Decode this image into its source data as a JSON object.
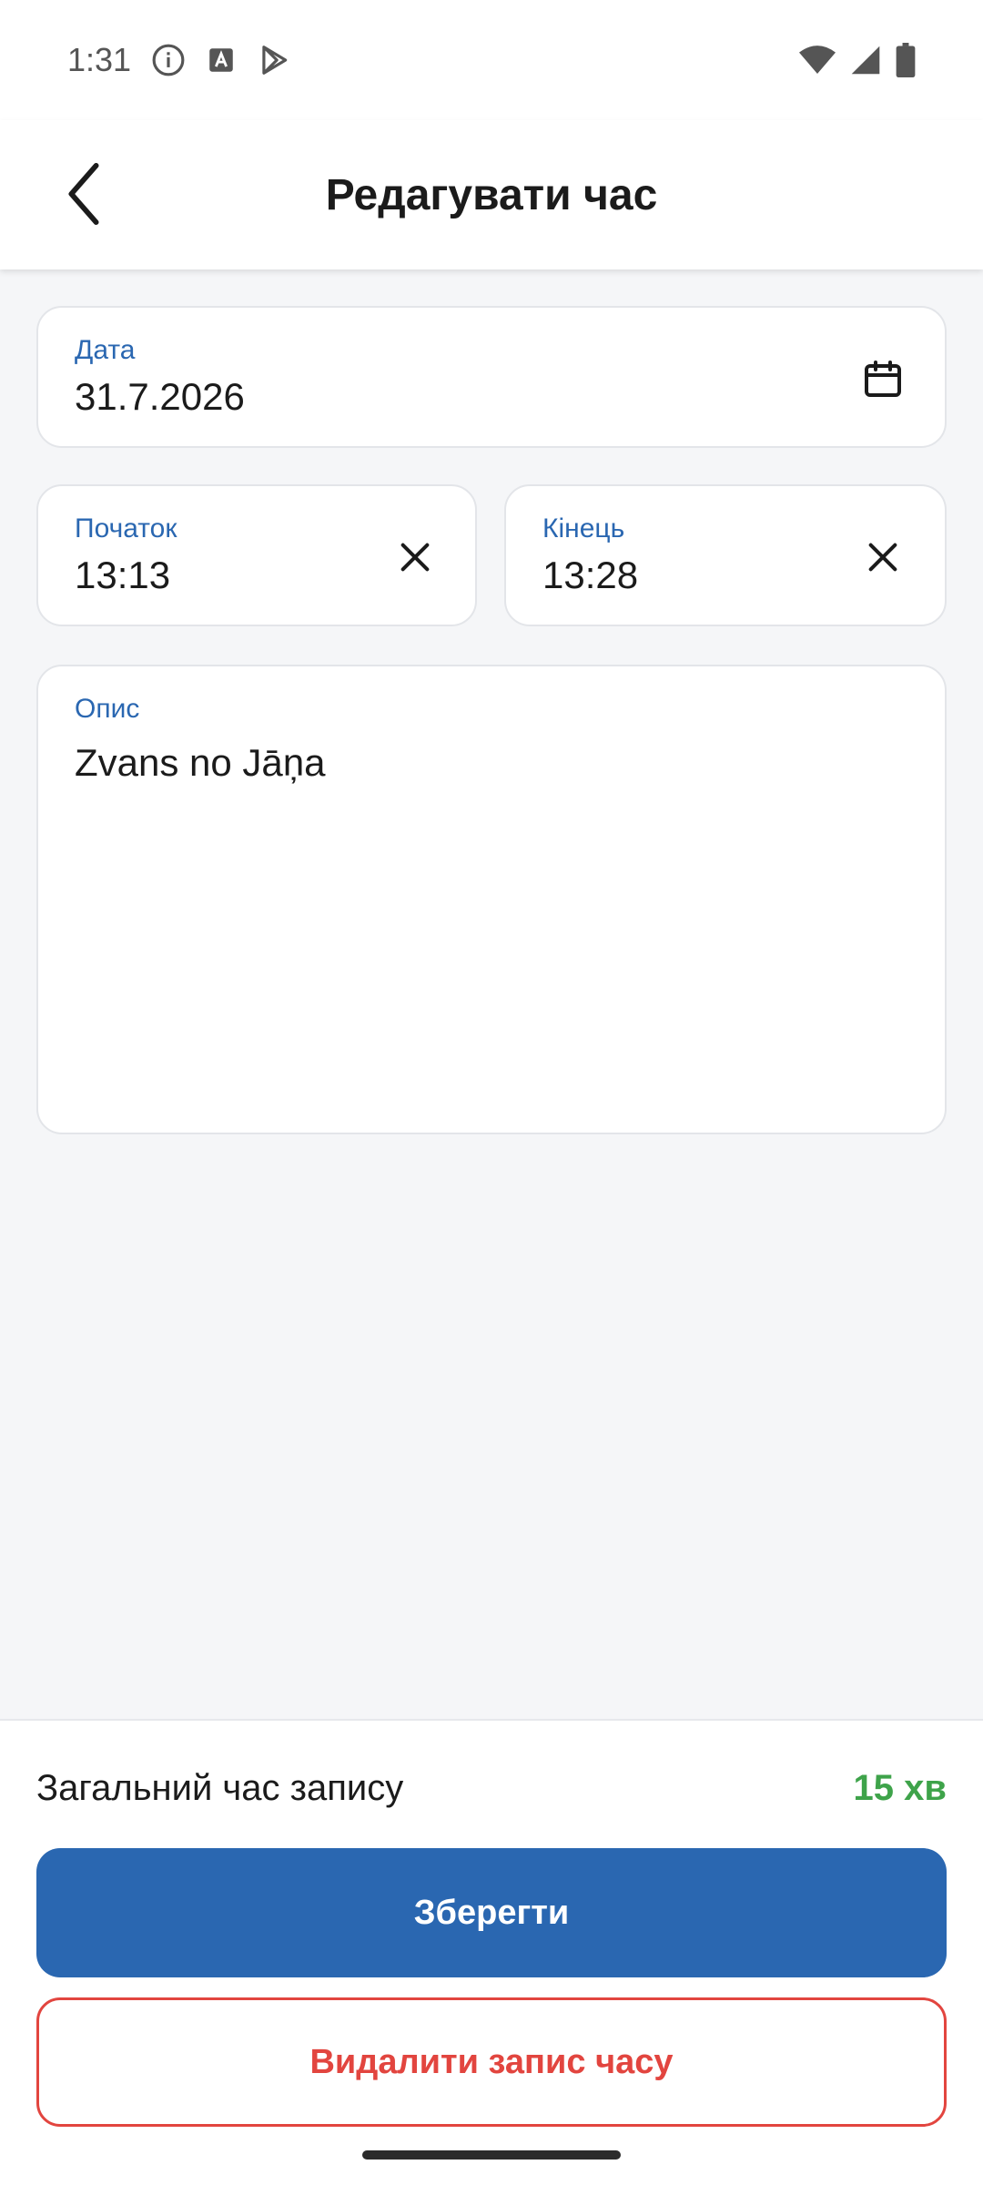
{
  "status_bar": {
    "time": "1:31",
    "icons_left": [
      "info-icon",
      "text-a-icon",
      "play-store-icon"
    ],
    "icons_right": [
      "wifi-icon",
      "cell-signal-icon",
      "battery-icon"
    ]
  },
  "app_bar": {
    "back_icon": "chevron-left-icon",
    "title": "Редагувати час"
  },
  "form": {
    "date": {
      "label": "Дата",
      "value": "31.7.2026",
      "icon": "calendar-icon"
    },
    "start": {
      "label": "Початок",
      "value": "13:13",
      "icon": "close-icon"
    },
    "end": {
      "label": "Кінець",
      "value": "13:28",
      "icon": "close-icon"
    },
    "description": {
      "label": "Опис",
      "value": "Zvans no Jāņa"
    }
  },
  "summary": {
    "total_label": "Загальний час запису",
    "total_value": "15 хв",
    "total_color": "#3ea34a"
  },
  "actions": {
    "save_label": "Зберегти",
    "delete_label": "Видалити запис часу",
    "primary_color": "#2a67b1",
    "danger_color": "#e2453f"
  }
}
